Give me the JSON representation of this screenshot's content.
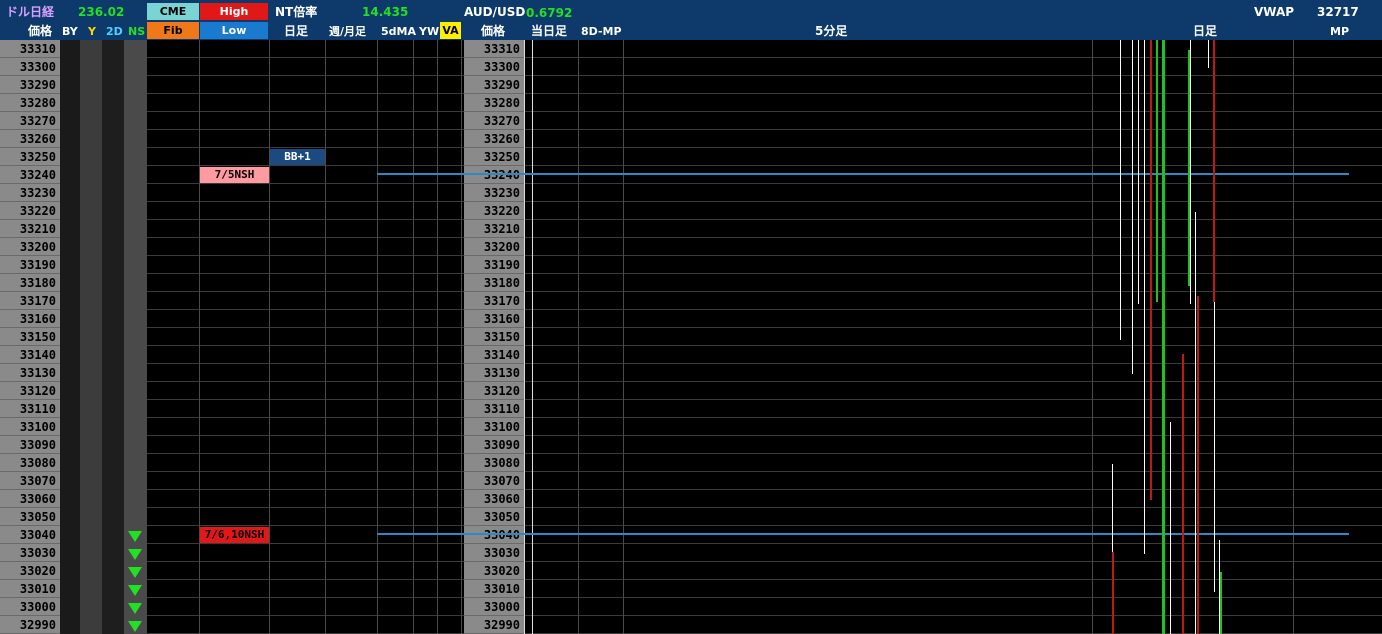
{
  "header": {
    "dollar_nikkei_label": "ドル日経",
    "dollar_nikkei_value": "236.02",
    "cme_button": "CME",
    "high_button": "High",
    "fib_button": "Fib",
    "low_button": "Low",
    "nt_ratio_label": "NT倍率",
    "nt_ratio_value": "14.435",
    "audusd_label": "AUD/USD",
    "audusd_value": "0.6792",
    "vwap_label": "VWAP",
    "vwap_value": "32717"
  },
  "columns": {
    "price": "価格",
    "by": "BY",
    "y": "Y",
    "twod": "2D",
    "ns": "NS",
    "daily": "日足",
    "weekly_monthly": "週/月足",
    "fivedma": "5dMA",
    "yw": "YW",
    "va": "VA",
    "price2": "価格",
    "today": "当日足",
    "eightd_mp": "8D-MP",
    "five_min": "5分足",
    "daily2": "日足",
    "mp": "MP"
  },
  "prices": [
    "33310",
    "33300",
    "33290",
    "33280",
    "33270",
    "33260",
    "33250",
    "33240",
    "33230",
    "33220",
    "33210",
    "33200",
    "33190",
    "33180",
    "33170",
    "33160",
    "33150",
    "33140",
    "33130",
    "33120",
    "33110",
    "33100",
    "33090",
    "33080",
    "33070",
    "33060",
    "33050",
    "33040",
    "33030",
    "33020",
    "33010",
    "33000",
    "32990"
  ],
  "markers": {
    "bb_plus_1": "BB+1",
    "nsh_75": "7/5NSH",
    "nsh_610": "7/6,10NSH"
  },
  "colors": {
    "header_bg": "#0d3a6a",
    "price_col_bg": "#8a8a8a",
    "up_bar": "#22c022",
    "down_bar": "#c01818",
    "level_line": "#2a8ac8"
  }
}
